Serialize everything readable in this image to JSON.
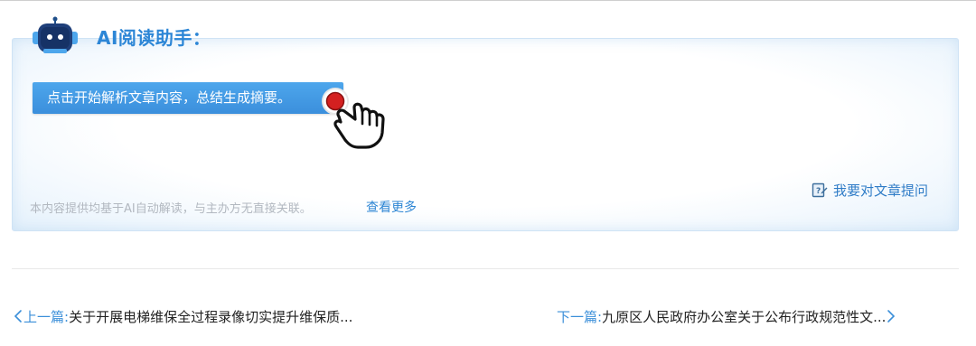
{
  "assistant": {
    "title": "AI阅读助手：",
    "start_label": "点击开始解析文章内容，总结生成摘要。",
    "disclaimer": "本内容提供均基于AI自动解读，与主办方无直接关联。",
    "view_more": "查看更多",
    "ask_label": "我要对文章提问"
  },
  "navigation": {
    "prev_label": "上一篇:",
    "prev_title": "关于开展电梯维保全过程录像切实提升维保质...",
    "next_label": "下一篇:",
    "next_title": "九原区人民政府办公室关于公布行政规范性文..."
  },
  "icons": {
    "robot": "robot-icon",
    "pointer": "hand-pointer-icon",
    "ask": "edit-question-icon",
    "prev": "chevron-left-icon",
    "next": "chevron-right-icon"
  },
  "colors": {
    "accent": "#2c86d6",
    "button": "#3b8fdc",
    "cursor_dot": "#d42020"
  }
}
